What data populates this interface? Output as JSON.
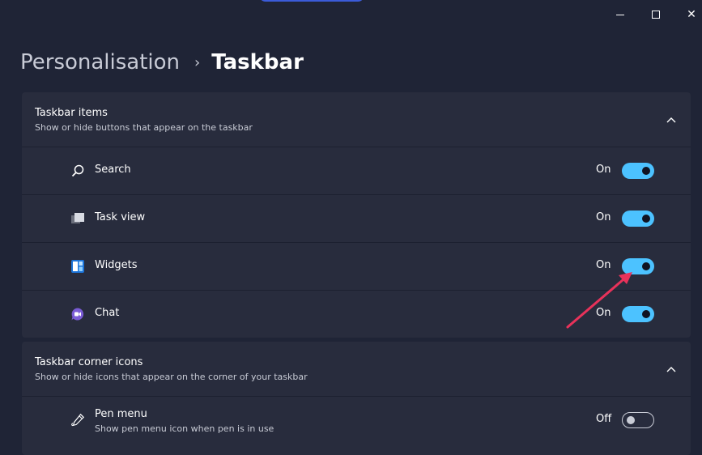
{
  "window": {
    "minimize_glyph": "—",
    "maximize_glyph": "☐",
    "close_glyph": "✕"
  },
  "breadcrumb": {
    "parent": "Personalisation",
    "separator": "›",
    "current": "Taskbar"
  },
  "taskbar_items": {
    "title": "Taskbar items",
    "subtitle": "Show or hide buttons that appear on the taskbar",
    "expanded": true,
    "items": [
      {
        "label": "Search",
        "state": "On",
        "icon": "search-icon"
      },
      {
        "label": "Task view",
        "state": "On",
        "icon": "task-view-icon"
      },
      {
        "label": "Widgets",
        "state": "On",
        "icon": "widgets-icon"
      },
      {
        "label": "Chat",
        "state": "On",
        "icon": "chat-icon"
      }
    ]
  },
  "corner_icons": {
    "title": "Taskbar corner icons",
    "subtitle": "Show or hide icons that appear on the corner of your taskbar",
    "expanded": true,
    "items": [
      {
        "label": "Pen menu",
        "description": "Show pen menu icon when pen is in use",
        "state": "Off",
        "icon": "pen-icon"
      }
    ]
  },
  "colors": {
    "accent": "#4cc2ff",
    "background": "#1f2436",
    "card": "#282c3d",
    "annotation_arrow": "#e8325a"
  }
}
